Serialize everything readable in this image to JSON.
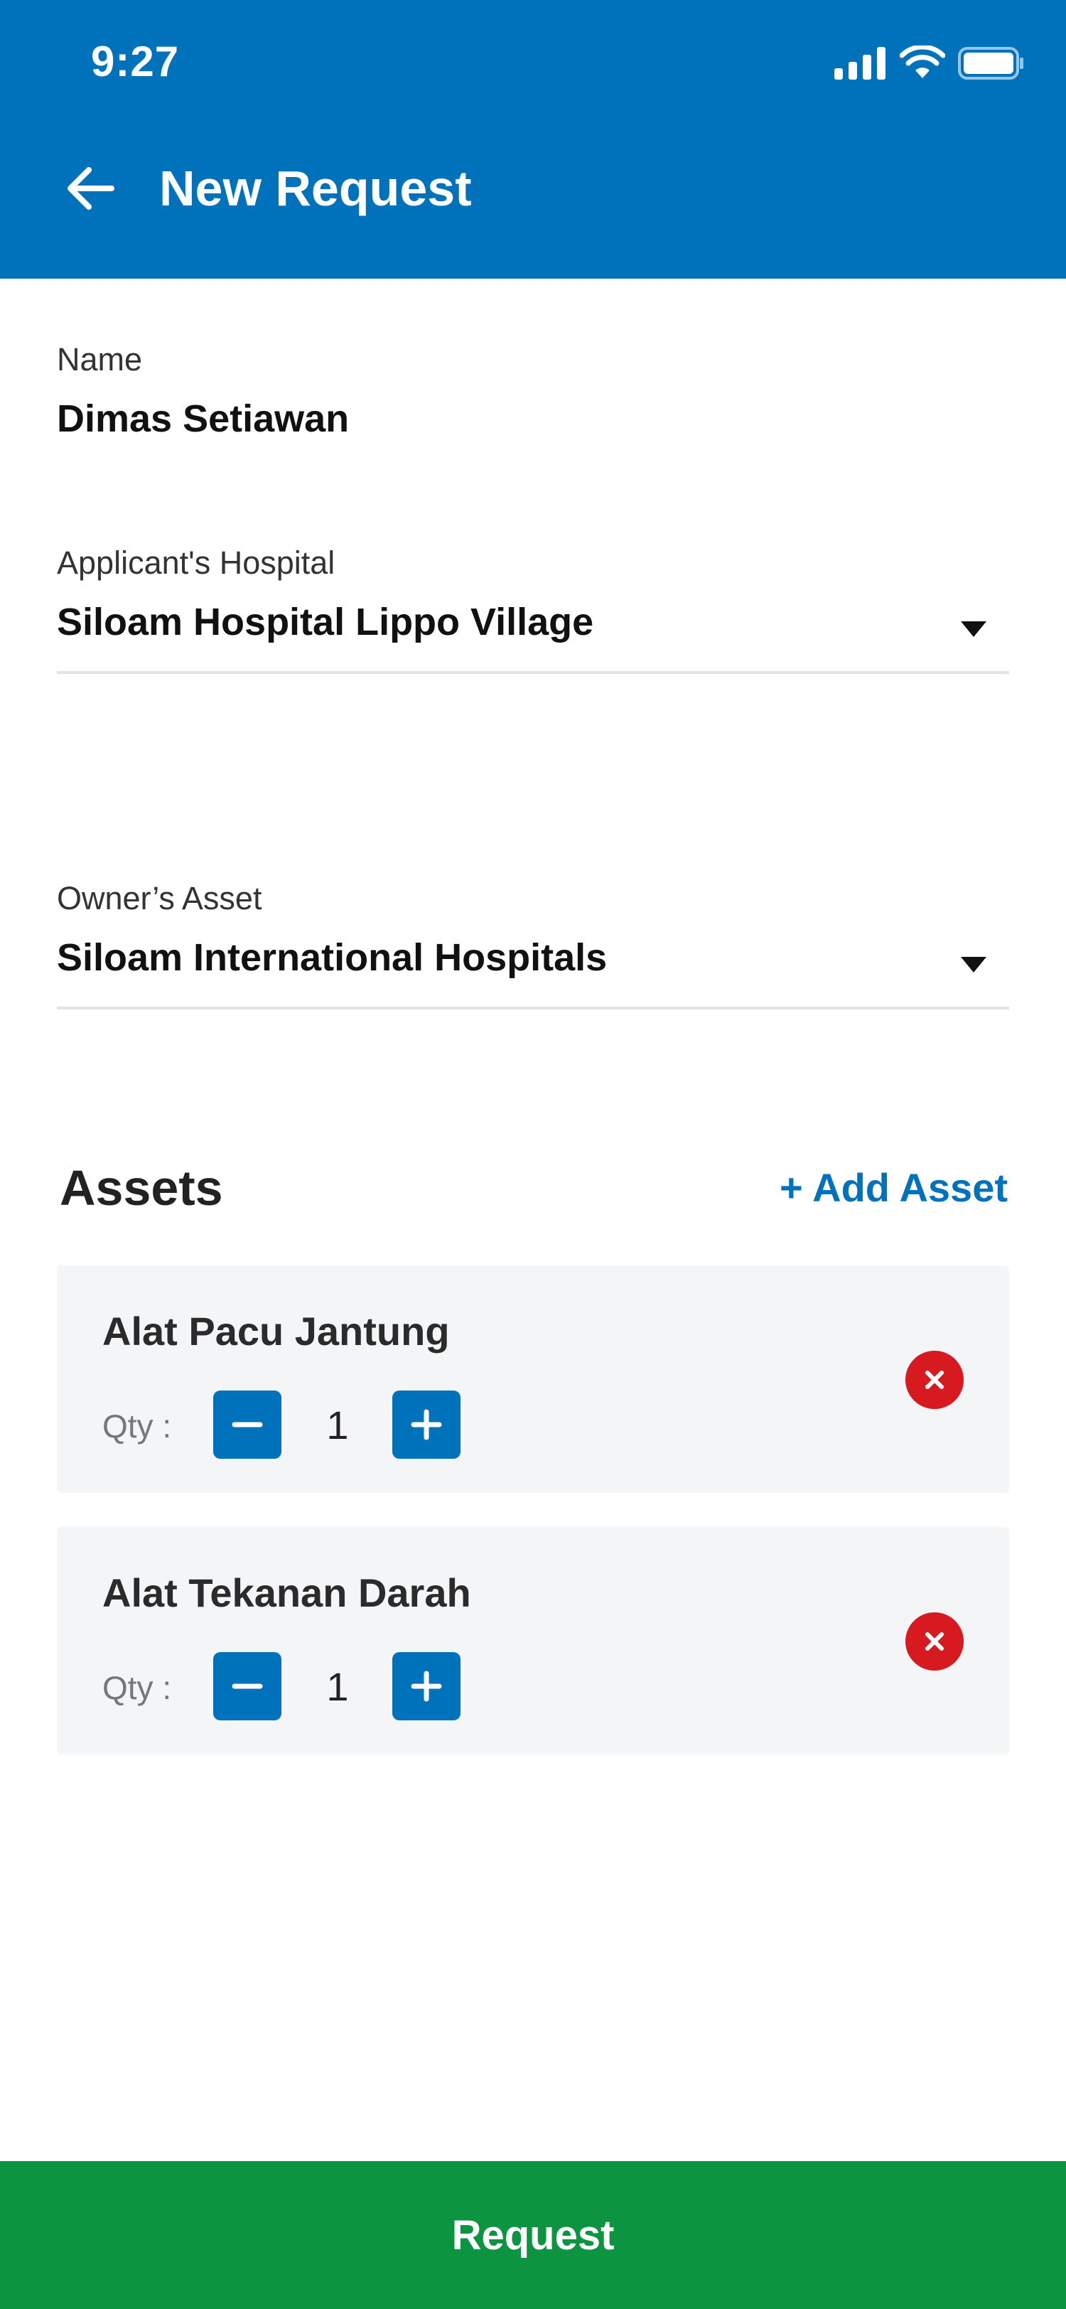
{
  "status_bar": {
    "time": "9:27",
    "icons": [
      "signal-icon",
      "wifi-icon",
      "battery-icon"
    ]
  },
  "header": {
    "title": "New Request",
    "back_icon": "arrow-left-icon"
  },
  "form": {
    "name": {
      "label": "Name",
      "value": "Dimas Setiawan"
    },
    "applicant_hospital": {
      "label": "Applicant's Hospital",
      "value": "Siloam Hospital Lippo Village"
    },
    "owner_asset": {
      "label": "Owner’s Asset",
      "value": "Siloam International Hospitals"
    }
  },
  "assets": {
    "title": "Assets",
    "add_label": "+ Add Asset",
    "qty_label": "Qty :",
    "items": [
      {
        "name": "Alat Pacu Jantung",
        "qty": "1"
      },
      {
        "name": "Alat Tekanan Darah",
        "qty": "1"
      }
    ]
  },
  "footer": {
    "request_label": "Request"
  },
  "colors": {
    "primary": "#0072BC",
    "success": "#0C9440",
    "danger": "#D71920",
    "card_bg": "#F4F5F7"
  }
}
